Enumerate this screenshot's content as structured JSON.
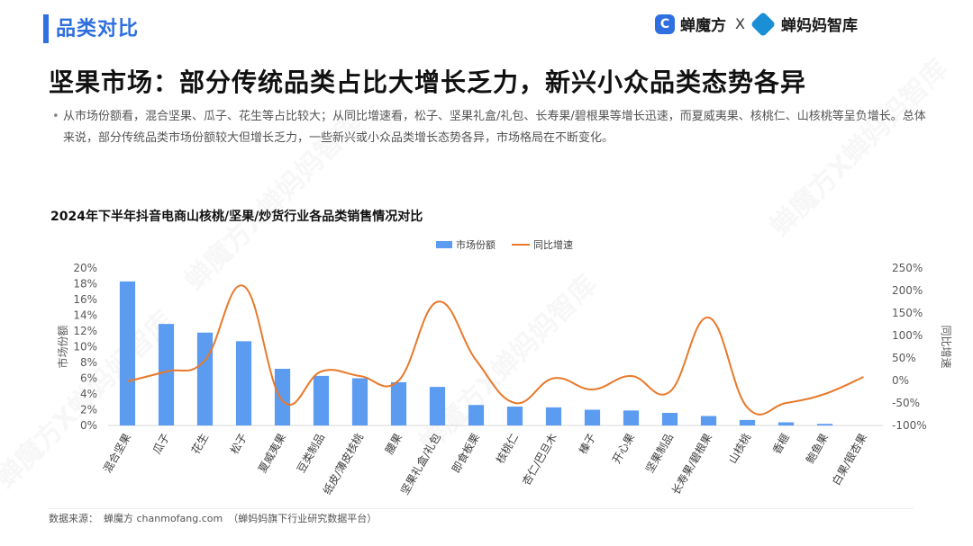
{
  "header": {
    "section_title": "品类对比",
    "logo1_text": "蝉魔方",
    "logo_x": "X",
    "logo2_text": "蝉妈妈智库"
  },
  "headline": "坚果市场：部分传统品类占比大增长乏力，新兴小众品类态势各异",
  "description": "从市场份额看，混合坚果、瓜子、花生等占比较大；从同比增速看，松子、坚果礼盒/礼包、长寿果/碧根果等增长迅速，而夏威夷果、核桃仁、山核桃等呈负增长。总体来说，部分传统品类市场份额较大但增长乏力，一些新兴或小众品类增长态势各异，市场格局在不断变化。",
  "description_bullet": "•",
  "watermark": "蝉魔方X蝉妈妈智库",
  "source": {
    "label": "数据来源：",
    "name": "蝉魔方 chanmofang.com",
    "note": "（蝉妈妈旗下行业研究数据平台）"
  },
  "colors": {
    "accent": "#2f6fe0",
    "bar": "#5b9bf0",
    "line": "#e8792a"
  },
  "chart_data": {
    "type": "bar",
    "title": "2024年下半年抖音电商山核桃/坚果/炒货行业各品类销售情况对比",
    "categories": [
      "混合坚果",
      "瓜子",
      "花生",
      "松子",
      "夏威夷果",
      "豆类制品",
      "纸皮/薄皮核桃",
      "腰果",
      "坚果礼盒/礼包",
      "即食板栗",
      "核桃仁",
      "杏仁/巴旦木",
      "榛子",
      "开心果",
      "坚果制品",
      "长寿果/碧根果",
      "山核桃",
      "香榧",
      "鲍鱼果",
      "白果/银杏果"
    ],
    "series": [
      {
        "name": "市场份额",
        "type": "bar",
        "axis": "left",
        "unit": "%",
        "values": [
          18.3,
          12.9,
          11.8,
          10.7,
          7.2,
          6.3,
          6.0,
          5.5,
          4.9,
          2.6,
          2.4,
          2.3,
          2.0,
          1.9,
          1.6,
          1.2,
          0.7,
          0.4,
          0.2,
          0.0
        ]
      },
      {
        "name": "同比增速",
        "type": "line",
        "axis": "right",
        "unit": "%",
        "values": [
          -2,
          20,
          45,
          210,
          -45,
          20,
          10,
          0,
          175,
          45,
          -50,
          5,
          -20,
          10,
          -25,
          140,
          -60,
          -50,
          -30,
          8
        ]
      }
    ],
    "ylabel_left": "市场份额",
    "ylabel_right": "同比增速",
    "ylim_left": [
      0,
      20
    ],
    "ylim_right": [
      -100,
      250
    ],
    "yticks_left": [
      "0%",
      "2%",
      "4%",
      "6%",
      "8%",
      "10%",
      "12%",
      "14%",
      "16%",
      "18%",
      "20%"
    ],
    "yticks_right": [
      "-100%",
      "-50%",
      "0%",
      "50%",
      "100%",
      "150%",
      "200%",
      "250%"
    ],
    "legend": "top-center",
    "grid": false
  }
}
